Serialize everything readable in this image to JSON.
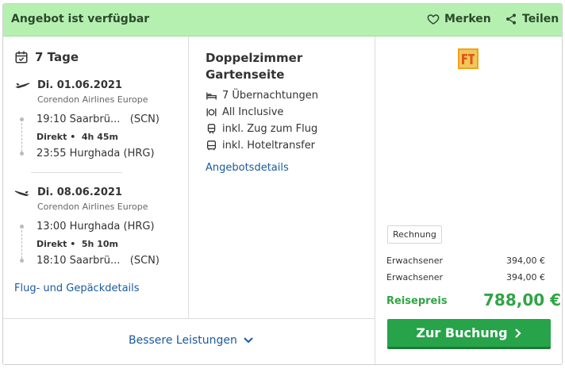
{
  "header": {
    "title": "Angebot ist verfügbar",
    "save_label": "Merken",
    "share_label": "Teilen"
  },
  "trip": {
    "duration": "7 Tage",
    "outbound": {
      "date": "Di. 01.06.2021",
      "airline": "Corendon Airlines Europe",
      "depart_time": "19:10 Saarbrü...",
      "depart_code": "(SCN)",
      "direct": "Direkt",
      "duration": "4h 45m",
      "arrive": "23:55 Hurghada (HRG)"
    },
    "inbound": {
      "date": "Di. 08.06.2021",
      "airline": "Corendon Airlines Europe",
      "depart": "13:00 Hurghada (HRG)",
      "direct": "Direkt",
      "duration": "5h 10m",
      "arrive_time": "18:10 Saarbrü...",
      "arrive_code": "(SCN)"
    },
    "flight_details_link": "Flug- und Gepäckdetails"
  },
  "room": {
    "title": "Doppelzimmer Gartenseite",
    "features": [
      {
        "icon": "bed-icon",
        "label": "7 Übernachtungen"
      },
      {
        "icon": "meal-icon",
        "label": "All Inclusive"
      },
      {
        "icon": "train-icon",
        "label": "inkl. Zug zum Flug"
      },
      {
        "icon": "bus-icon",
        "label": "inkl. Hoteltransfer"
      }
    ],
    "details_link": "Angebotsdetails"
  },
  "pricing": {
    "invoice_badge": "Rechnung",
    "rows": [
      {
        "label": "Erwachsener",
        "price": "394,00 €"
      },
      {
        "label": "Erwachsener",
        "price": "394,00 €"
      }
    ],
    "total_label": "Reisepreis",
    "total": "788,00 €",
    "book_label": "Zur Buchung"
  },
  "footer": {
    "more_label": "Bessere Leistungen"
  },
  "colors": {
    "header_bg": "#b6f0b1",
    "accent_green": "#27a34a",
    "link_blue": "#1a5a9c"
  }
}
